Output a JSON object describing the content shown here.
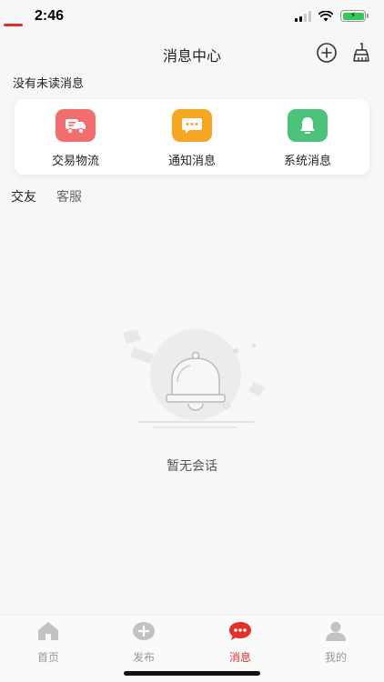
{
  "status_bar": {
    "time": "2:46"
  },
  "nav": {
    "title": "消息中心",
    "add_icon": "plus-circle-icon",
    "clean_icon": "broom-icon"
  },
  "unread_text": "没有未读消息",
  "categories": [
    {
      "label": "交易物流",
      "icon": "truck-icon",
      "color": "#f26d6d"
    },
    {
      "label": "通知消息",
      "icon": "chat-bubble-icon",
      "color": "#f5a623"
    },
    {
      "label": "系统消息",
      "icon": "bell-icon",
      "color": "#4cc27a"
    }
  ],
  "tabs": [
    {
      "label": "交友",
      "active": true
    },
    {
      "label": "客服",
      "active": false
    }
  ],
  "empty_state": {
    "text": "暂无会话",
    "icon": "empty-bell-illustration"
  },
  "tab_bar": [
    {
      "label": "首页",
      "icon": "home-icon",
      "active": false
    },
    {
      "label": "发布",
      "icon": "publish-plus-icon",
      "active": false
    },
    {
      "label": "消息",
      "icon": "message-icon",
      "active": true
    },
    {
      "label": "我的",
      "icon": "profile-icon",
      "active": false
    }
  ],
  "colors": {
    "accent": "#e2302b",
    "background": "#f7f7f7",
    "inactive": "#999999"
  }
}
